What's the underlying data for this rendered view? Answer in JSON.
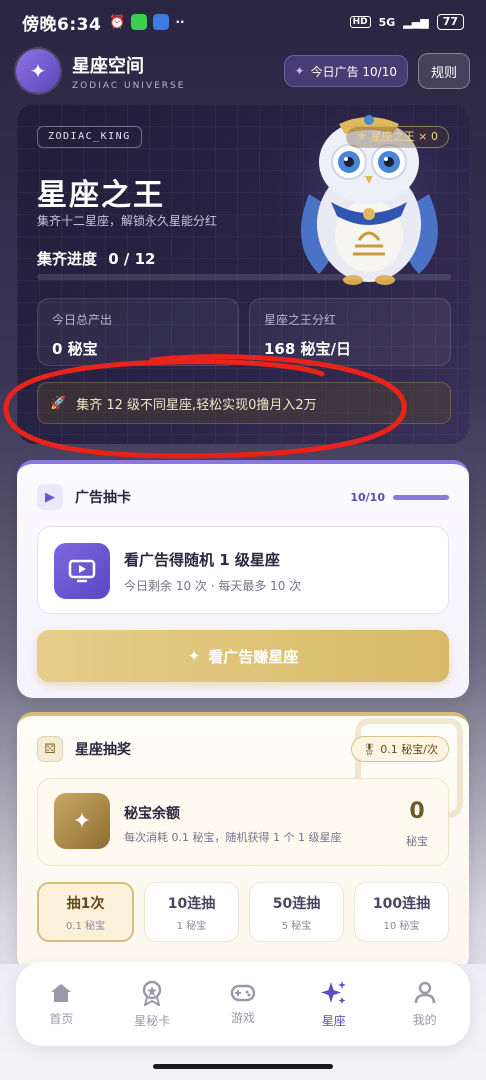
{
  "status": {
    "time": "傍晚6:34",
    "network": "5G",
    "battery": "77"
  },
  "header": {
    "title": "星座空间",
    "subtitle": "ZODIAC UNIVERSE",
    "ad_badge": "今日广告 10/10",
    "rules": "规则"
  },
  "hero": {
    "tag": "ZODIAC_KING",
    "king_count": "星座之王 × 0",
    "title": "星座之王",
    "desc": "集齐十二星座，解锁永久星能分红",
    "progress_label": "集齐进度",
    "progress_value": "0 / 12",
    "progress_fraction": 0,
    "stats": [
      {
        "label": "今日总产出",
        "value": "0 秘宝"
      },
      {
        "label": "星座之王分红",
        "value": "168 秘宝/日"
      }
    ],
    "promo": "集齐 12 级不同星座,轻松实现0撸月入2万"
  },
  "ad_card": {
    "title": "广告抽卡",
    "count": "10/10",
    "main": "看广告得随机 1 级星座",
    "sub": "今日剩余 10 次 · 每天最多 10 次",
    "button": "看广告赚星座"
  },
  "lottery_card": {
    "title": "星座抽奖",
    "cost_badge": "0.1 秘宝/次",
    "balance_title": "秘宝余额",
    "balance_desc": "每次消耗 0.1 秘宝，随机获得 1 个 1 级星座",
    "balance_value": "0",
    "balance_unit": "秘宝",
    "draws": [
      {
        "label": "抽1次",
        "cost": "0.1 秘宝",
        "active": true
      },
      {
        "label": "10连抽",
        "cost": "1 秘宝",
        "active": false
      },
      {
        "label": "50连抽",
        "cost": "5 秘宝",
        "active": false
      },
      {
        "label": "100连抽",
        "cost": "10 秘宝",
        "active": false
      }
    ]
  },
  "nav": [
    {
      "label": "首页",
      "icon": "home-icon"
    },
    {
      "label": "星秘卡",
      "icon": "medal-icon"
    },
    {
      "label": "游戏",
      "icon": "gamepad-icon"
    },
    {
      "label": "星座",
      "icon": "sparkles-icon",
      "active": true
    },
    {
      "label": "我的",
      "icon": "user-icon"
    }
  ],
  "colors": {
    "accent": "#5d4dc0",
    "gold": "#d7b968",
    "annotation": "#e8231a"
  }
}
